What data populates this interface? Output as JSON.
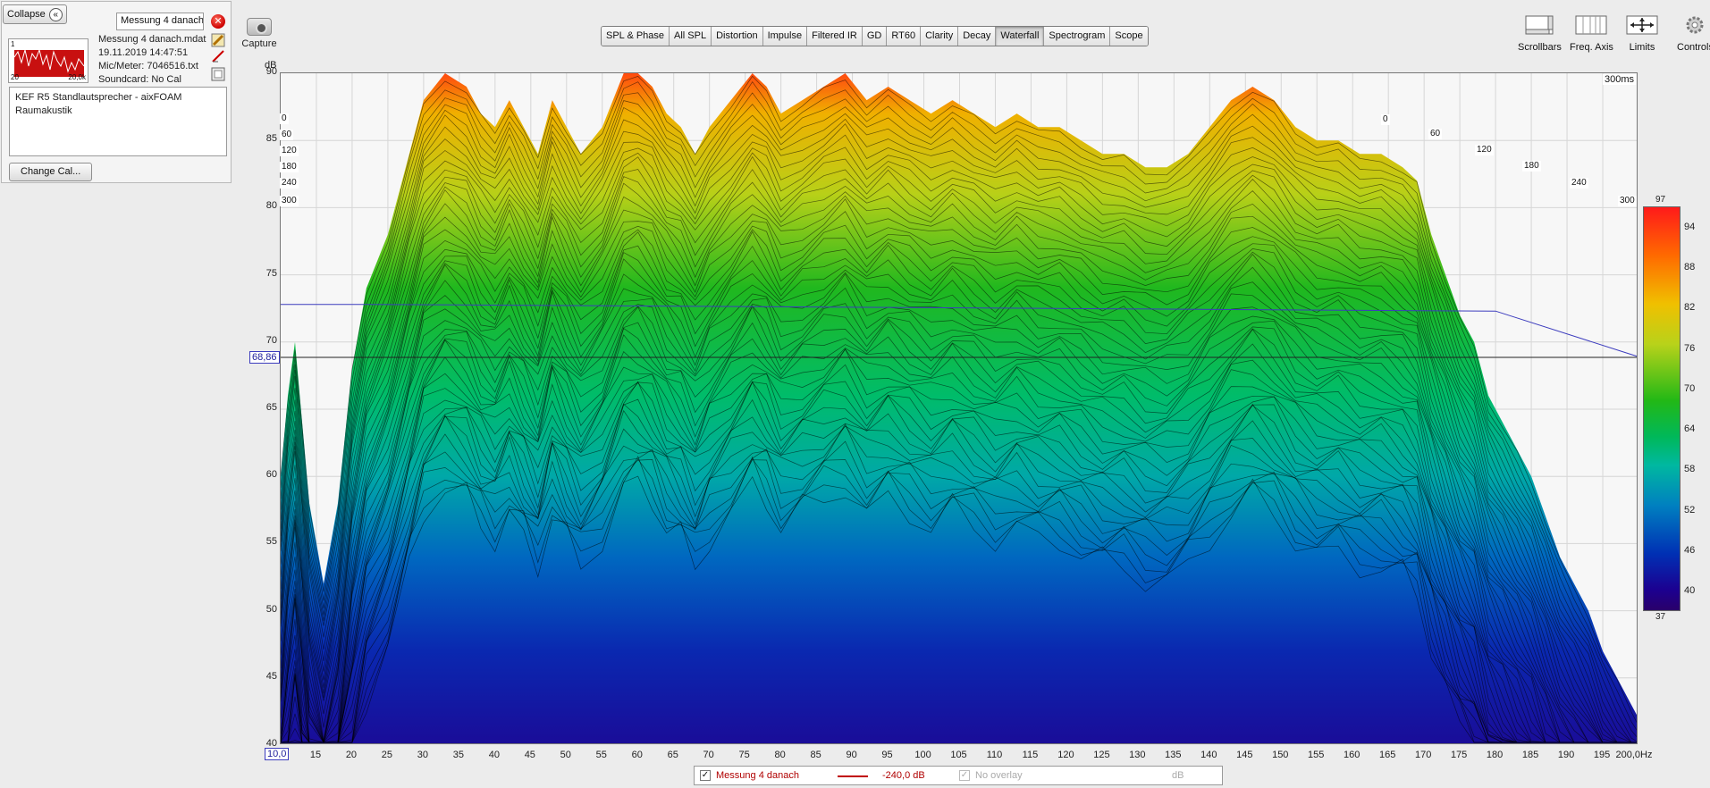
{
  "panel": {
    "collapse_label": "Collapse",
    "collapse_icon": "«",
    "measurement_name": "Messung 4 danach",
    "thumb_left": "20",
    "thumb_right": "20,0k",
    "thumb_top": "1",
    "file": "Messung 4 danach.mdat",
    "date": "19.11.2019 14:47:51",
    "mic": "Mic/Meter: 7046516.txt",
    "soundcard": "Soundcard: No Cal",
    "notes_line1": "KEF R5 Standlautsprecher - aixFOAM",
    "notes_line2": "Raumakustik",
    "change_cal": "Change Cal...",
    "close_glyph": "✕"
  },
  "toolbar": {
    "capture": "Capture",
    "tabs": [
      "SPL & Phase",
      "All SPL",
      "Distortion",
      "Impulse",
      "Filtered IR",
      "GD",
      "RT60",
      "Clarity",
      "Decay",
      "Waterfall",
      "Spectrogram",
      "Scope"
    ],
    "active_tab": "Waterfall",
    "right": [
      "Scrollbars",
      "Freq. Axis",
      "Limits",
      "Controls"
    ]
  },
  "graph": {
    "y_unit": "dB",
    "y_ticks": [
      "90",
      "85",
      "80",
      "75",
      "70",
      "65",
      "60",
      "55",
      "50",
      "45",
      "40"
    ],
    "x_ticks": [
      "15",
      "20",
      "25",
      "30",
      "35",
      "40",
      "45",
      "50",
      "55",
      "60",
      "65",
      "70",
      "75",
      "80",
      "85",
      "90",
      "95",
      "100",
      "105",
      "110",
      "115",
      "120",
      "125",
      "130",
      "135",
      "140",
      "145",
      "150",
      "155",
      "160",
      "165",
      "170",
      "175",
      "180",
      "185",
      "190",
      "195",
      "200,0Hz"
    ],
    "x_cursor": "10,0",
    "y_cursor": "68,86",
    "time_top": "300ms",
    "time_left": [
      "0",
      "60",
      "120",
      "180",
      "240",
      "300"
    ],
    "time_right": [
      "0",
      "60",
      "120",
      "180",
      "240",
      "300"
    ]
  },
  "scale": {
    "max": "97",
    "min": "37",
    "ticks": [
      "94",
      "88",
      "82",
      "76",
      "70",
      "64",
      "58",
      "52",
      "46",
      "40"
    ]
  },
  "legend": {
    "name": "Messung 4 danach",
    "offset": "-240,0 dB",
    "overlay": "No overlay",
    "unit": "dB"
  },
  "colors": {
    "accent_red": "#c00000",
    "cursor_blue": "#3c3cbe"
  }
}
